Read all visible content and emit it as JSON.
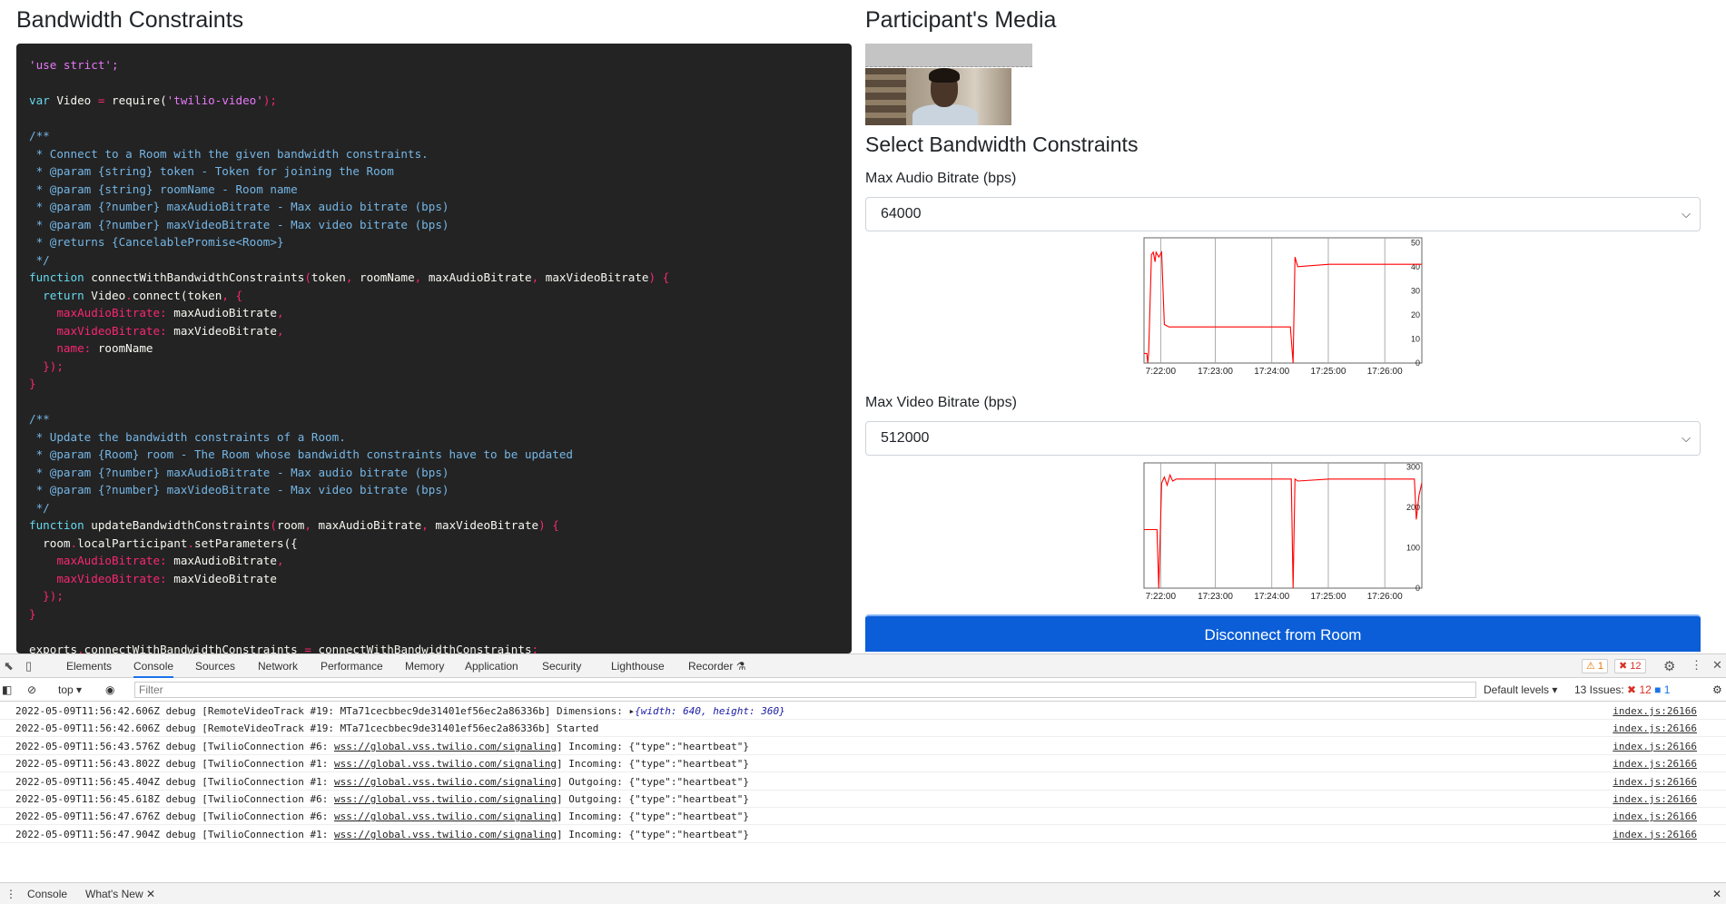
{
  "left": {
    "title": "Bandwidth Constraints",
    "code_lines": [
      [
        [
          "'use strict';",
          "str"
        ]
      ],
      [],
      [
        [
          "var",
          "k"
        ],
        [
          " Video ",
          ""
        ],
        [
          "=",
          "r"
        ],
        [
          " require(",
          ""
        ],
        [
          "'twilio-video'",
          "str"
        ],
        [
          ");",
          "r"
        ]
      ],
      [],
      [
        [
          "/**",
          "c"
        ]
      ],
      [
        [
          " * Connect to a Room with the given bandwidth constraints.",
          "c"
        ]
      ],
      [
        [
          " * @param {string} token - Token for joining the Room",
          "c"
        ]
      ],
      [
        [
          " * @param {string} roomName - Room name",
          "c"
        ]
      ],
      [
        [
          " * @param {?number} maxAudioBitrate - Max audio bitrate (bps)",
          "c"
        ]
      ],
      [
        [
          " * @param {?number} maxVideoBitrate - Max video bitrate (bps)",
          "c"
        ]
      ],
      [
        [
          " * @returns {CancelablePromise<Room>}",
          "c"
        ]
      ],
      [
        [
          " */",
          "c"
        ]
      ],
      [
        [
          "function",
          "k"
        ],
        [
          " connectWithBandwidthConstraints",
          ""
        ],
        [
          "(",
          "r"
        ],
        [
          "token",
          ""
        ],
        [
          ", ",
          "r"
        ],
        [
          "roomName",
          ""
        ],
        [
          ", ",
          "r"
        ],
        [
          "maxAudioBitrate",
          ""
        ],
        [
          ", ",
          "r"
        ],
        [
          "maxVideoBitrate",
          ""
        ],
        [
          ") {",
          "r"
        ]
      ],
      [
        [
          "  return",
          "k"
        ],
        [
          " Video",
          ""
        ],
        [
          ".",
          "r"
        ],
        [
          "connect(",
          ""
        ],
        [
          "token",
          ""
        ],
        [
          ", {",
          "r"
        ]
      ],
      [
        [
          "    maxAudioBitrate:",
          "r"
        ],
        [
          " maxAudioBitrate",
          ""
        ],
        [
          ",",
          "r"
        ]
      ],
      [
        [
          "    maxVideoBitrate:",
          "r"
        ],
        [
          " maxVideoBitrate",
          ""
        ],
        [
          ",",
          "r"
        ]
      ],
      [
        [
          "    name:",
          "r"
        ],
        [
          " roomName",
          ""
        ]
      ],
      [
        [
          "  });",
          "r"
        ]
      ],
      [
        [
          "}",
          "r"
        ]
      ],
      [],
      [
        [
          "/**",
          "c"
        ]
      ],
      [
        [
          " * Update the bandwidth constraints of a Room.",
          "c"
        ]
      ],
      [
        [
          " * @param {Room} room - The Room whose bandwidth constraints have to be updated",
          "c"
        ]
      ],
      [
        [
          " * @param {?number} maxAudioBitrate - Max audio bitrate (bps)",
          "c"
        ]
      ],
      [
        [
          " * @param {?number} maxVideoBitrate - Max video bitrate (bps)",
          "c"
        ]
      ],
      [
        [
          " */",
          "c"
        ]
      ],
      [
        [
          "function",
          "k"
        ],
        [
          " updateBandwidthConstraints",
          ""
        ],
        [
          "(",
          "r"
        ],
        [
          "room",
          ""
        ],
        [
          ", ",
          "r"
        ],
        [
          "maxAudioBitrate",
          ""
        ],
        [
          ", ",
          "r"
        ],
        [
          "maxVideoBitrate",
          ""
        ],
        [
          ") {",
          "r"
        ]
      ],
      [
        [
          "  room",
          ""
        ],
        [
          ".",
          "r"
        ],
        [
          "localParticipant",
          ""
        ],
        [
          ".",
          "r"
        ],
        [
          "setParameters({",
          ""
        ]
      ],
      [
        [
          "    maxAudioBitrate:",
          "r"
        ],
        [
          " maxAudioBitrate",
          ""
        ],
        [
          ",",
          "r"
        ]
      ],
      [
        [
          "    maxVideoBitrate:",
          "r"
        ],
        [
          " maxVideoBitrate",
          ""
        ]
      ],
      [
        [
          "  });",
          "r"
        ]
      ],
      [
        [
          "}",
          "r"
        ]
      ],
      [],
      [
        [
          "exports",
          ""
        ],
        [
          ".",
          "r"
        ],
        [
          "connectWithBandwidthConstraints ",
          ""
        ],
        [
          "=",
          "r"
        ],
        [
          " connectWithBandwidthConstraints",
          ""
        ],
        [
          ";",
          "r"
        ]
      ]
    ]
  },
  "right": {
    "title": "Participant's Media",
    "subtitle": "Select Bandwidth Constraints",
    "audio_label": "Max Audio Bitrate (bps)",
    "audio_value": "64000",
    "video_label": "Max Video Bitrate (bps)",
    "video_value": "512000",
    "disconnect_label": "Disconnect from Room"
  },
  "chart_data": [
    {
      "type": "line",
      "title": "",
      "xlabel": "",
      "ylabel": "",
      "x_ticks": [
        "7:22:00",
        "17:23:00",
        "17:24:00",
        "17:25:00",
        "17:26:00"
      ],
      "y_ticks": [
        "0",
        "10",
        "20",
        "30",
        "40",
        "50"
      ],
      "ylim": [
        0,
        52
      ],
      "xlim": [
        0,
        300
      ],
      "color": "#ff0000",
      "series": [
        {
          "x": [
            0,
            3,
            4,
            5,
            8,
            10,
            12,
            13,
            16,
            19,
            22,
            27,
            31,
            33,
            37,
            41,
            158,
            161,
            163,
            166,
            200,
            250,
            300
          ],
          "y": [
            4,
            4,
            0,
            4,
            45,
            46,
            42,
            46,
            44,
            46,
            16,
            15,
            15,
            15,
            15,
            15,
            15,
            0,
            44,
            40,
            41,
            41,
            41
          ]
        }
      ]
    },
    {
      "type": "line",
      "title": "",
      "xlabel": "",
      "ylabel": "",
      "x_ticks": [
        "7:22:00",
        "17:23:00",
        "17:24:00",
        "17:25:00",
        "17:26:00"
      ],
      "y_ticks": [
        "0",
        "100",
        "200",
        "300"
      ],
      "ylim": [
        0,
        310
      ],
      "xlim": [
        0,
        300
      ],
      "color": "#ff0000",
      "series": [
        {
          "x": [
            0,
            14,
            16,
            19,
            22,
            25,
            28,
            31,
            35,
            40,
            100,
            159,
            161,
            163,
            166,
            200,
            292,
            294,
            297,
            300
          ],
          "y": [
            145,
            145,
            0,
            260,
            275,
            255,
            280,
            265,
            270,
            270,
            270,
            270,
            0,
            270,
            265,
            270,
            270,
            170,
            230,
            260
          ]
        }
      ]
    }
  ],
  "devtools": {
    "tabs": [
      "Elements",
      "Console",
      "Sources",
      "Network",
      "Performance",
      "Memory",
      "Application",
      "Security",
      "Lighthouse",
      "Recorder"
    ],
    "active_tab": "Console",
    "warnings": "1",
    "errors": "12",
    "context": "top",
    "filter_placeholder": "Filter",
    "levels": "Default levels",
    "issues_label": "13 Issues:",
    "issues_errors": "12",
    "issues_info": "1",
    "logs": [
      {
        "pre": "2022-05-09T11:56:42.606Z debug [RemoteVideoTrack #19: MTa71cecbbec9de31401ef56ec2a86336b] Dimensions: ",
        "url": "",
        "post": "",
        "obj": "{width: 640, height: 360}",
        "src": "index.js:26166"
      },
      {
        "pre": "2022-05-09T11:56:42.606Z debug [RemoteVideoTrack #19: MTa71cecbbec9de31401ef56ec2a86336b] Started",
        "url": "",
        "post": "",
        "obj": "",
        "src": "index.js:26166"
      },
      {
        "pre": "2022-05-09T11:56:43.576Z debug [TwilioConnection #6: ",
        "url": "wss://global.vss.twilio.com/signaling",
        "post": "] Incoming: {\"type\":\"heartbeat\"}",
        "obj": "",
        "src": "index.js:26166"
      },
      {
        "pre": "2022-05-09T11:56:43.802Z debug [TwilioConnection #1: ",
        "url": "wss://global.vss.twilio.com/signaling",
        "post": "] Incoming: {\"type\":\"heartbeat\"}",
        "obj": "",
        "src": "index.js:26166"
      },
      {
        "pre": "2022-05-09T11:56:45.404Z debug [TwilioConnection #1: ",
        "url": "wss://global.vss.twilio.com/signaling",
        "post": "] Outgoing: {\"type\":\"heartbeat\"}",
        "obj": "",
        "src": "index.js:26166"
      },
      {
        "pre": "2022-05-09T11:56:45.618Z debug [TwilioConnection #6: ",
        "url": "wss://global.vss.twilio.com/signaling",
        "post": "] Outgoing: {\"type\":\"heartbeat\"}",
        "obj": "",
        "src": "index.js:26166"
      },
      {
        "pre": "2022-05-09T11:56:47.676Z debug [TwilioConnection #6: ",
        "url": "wss://global.vss.twilio.com/signaling",
        "post": "] Incoming: {\"type\":\"heartbeat\"}",
        "obj": "",
        "src": "index.js:26166"
      },
      {
        "pre": "2022-05-09T11:56:47.904Z debug [TwilioConnection #1: ",
        "url": "wss://global.vss.twilio.com/signaling",
        "post": "] Incoming: {\"type\":\"heartbeat\"}",
        "obj": "",
        "src": "index.js:26166"
      }
    ],
    "drawer_tabs": [
      "Console",
      "What's New"
    ]
  }
}
